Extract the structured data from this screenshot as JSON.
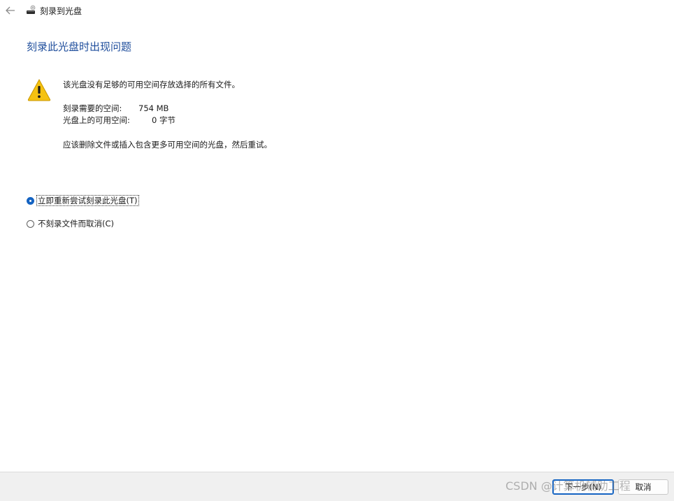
{
  "window": {
    "title": "刻录到光盘"
  },
  "heading": "刻录此光盘时出现问题",
  "message": {
    "line1": "该光盘没有足够的可用空间存放选择的所有文件。",
    "required_label": "刻录需要的空间:",
    "required_value": "754 MB",
    "available_label": "光盘上的可用空间:",
    "available_value": "0 字节",
    "advice": "应该删除文件或插入包含更多可用空间的光盘，然后重试。"
  },
  "options": [
    {
      "label": "立即重新尝试刻录此光盘(T)",
      "selected": true
    },
    {
      "label": "不刻录文件而取消(C)",
      "selected": false
    }
  ],
  "footer": {
    "next_label": "下一步(N)",
    "cancel_label": "取消"
  },
  "watermark": "CSDN @计算机辅助工程",
  "icons": {
    "back": "back-arrow-icon",
    "title": "disc-burner-icon",
    "warning": "warning-icon"
  },
  "colors": {
    "heading": "#1f4e9c",
    "accent": "#1463c2",
    "warning": "#f5c211",
    "footer_bg": "#f0f0f0"
  }
}
